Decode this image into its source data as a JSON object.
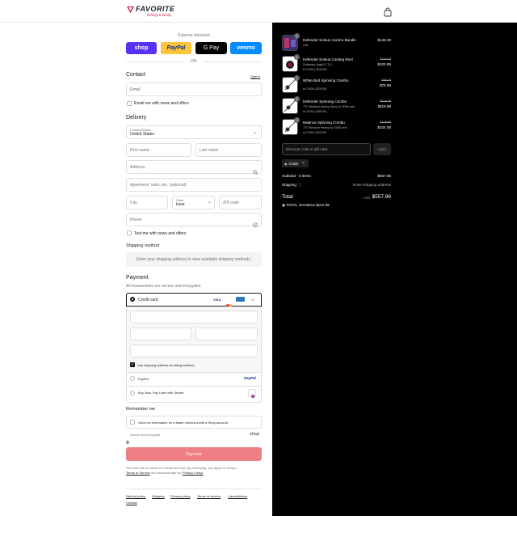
{
  "header": {
    "logo_text": "FAVORITE",
    "logo_tagline": "fishing & family"
  },
  "express": {
    "title": "Express checkout",
    "shop": "shop",
    "paypal": "PayPal",
    "gpay": "G Pay",
    "venmo": "venmo",
    "or": "OR"
  },
  "contact": {
    "title": "Contact",
    "sign_in": "Sign in",
    "email_placeholder": "Email",
    "newsletter": "Email me with news and offers"
  },
  "delivery": {
    "title": "Delivery",
    "country_label": "Country/Region",
    "country_value": "United States",
    "first_name": "First name",
    "last_name": "Last name",
    "address": "Address",
    "apartment": "Apartment, suite, etc. (optional)",
    "city": "City",
    "state_label": "State",
    "state_value": "Iowa",
    "zip": "ZIP code",
    "phone": "Phone",
    "sms": "Text me with news and offers"
  },
  "shipping": {
    "title": "Shipping method",
    "note": "Enter your shipping address to view available shipping methods."
  },
  "payment": {
    "title": "Payment",
    "subtitle": "All transactions are secure and encrypted.",
    "credit_card": "Credit card",
    "card_logos": [
      "VISA",
      "MC",
      "AMEX"
    ],
    "more": "+6",
    "billing_same": "Use shipping address as billing address",
    "paypal": "PayPal",
    "sezzle": "Buy Now, Pay Later with Sezzle"
  },
  "remember": {
    "title": "Remember me",
    "save_info": "Save my information for a faster checkout with a Shop account",
    "secure": "Secure and encrypted",
    "shop": "shop"
  },
  "pay_button": "Pay now",
  "legal": {
    "line1": "Your info will be saved to a Shop account. By continuing, you agree to Shop's",
    "terms": "Terms of Service",
    "and": "and acknowledge the",
    "privacy": "Privacy Policy."
  },
  "footer_links": [
    "Refund policy",
    "Shipping",
    "Privacy policy",
    "Terms of service",
    "Cancellations",
    "Contact"
  ],
  "products": [
    {
      "name": "Defender Soleus Combo Bundle",
      "variant": "Left",
      "discount": "",
      "original": "",
      "price": "$149.00",
      "qty": "1"
    },
    {
      "name": "Defender Soleus Casting Reel",
      "variant": "Defender (right) 7.3:1",
      "discount": "CH20 (-$26.00)",
      "original": "$129.99",
      "price": "$103.99",
      "qty": "1"
    },
    {
      "name": "White Bird Spinning Combo",
      "variant": "",
      "discount": "CH20 (-$20.00)",
      "original": "$99.99",
      "price": "$79.99",
      "qty": "1"
    },
    {
      "name": "Defender Spinning Combo",
      "variant": "7'0\" Medium Heavy (2pc) w/ 3000 reel",
      "discount": "CH20 (-$30.00)",
      "original": "$149.99",
      "price": "$119.99",
      "qty": "1"
    },
    {
      "name": "Balance Spinning Combo",
      "variant": "7'0\" Medium Heavy w/ 2000 reel",
      "discount": "CH20 (-$25.99)",
      "original": "$129.99",
      "price": "$104.00",
      "qty": "1"
    }
  ],
  "summary": {
    "discount_placeholder": "Discount code or gift card",
    "apply": "Apply",
    "code": "CH20",
    "subtotal_label": "Subtotal · 5 items",
    "subtotal": "$557.96",
    "shipping_label": "Shipping",
    "shipping_value": "Enter shipping address",
    "total_label": "Total",
    "currency": "USD",
    "total": "$557.96",
    "savings_label": "TOTAL SAVINGS",
    "savings": "$101.99"
  }
}
